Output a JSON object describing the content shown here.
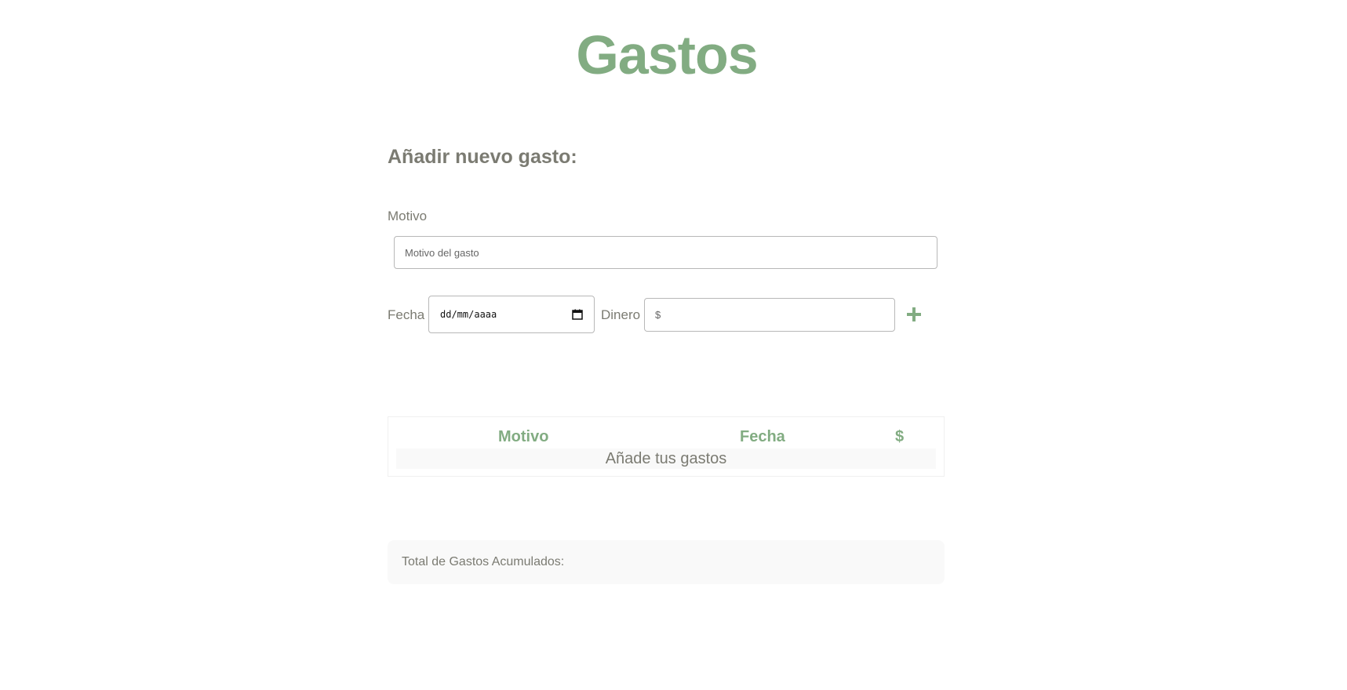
{
  "header": {
    "title": "Gastos"
  },
  "form": {
    "heading": "Añadir nuevo gasto:",
    "motivo_label": "Motivo",
    "motivo_placeholder": "Motivo del gasto",
    "fecha_label": "Fecha",
    "fecha_placeholder": "dd/mm/aaaa",
    "dinero_label": "Dinero",
    "dinero_placeholder": "$",
    "add_icon": "plus-icon"
  },
  "table": {
    "columns": [
      "Motivo",
      "Fecha",
      "$"
    ],
    "empty_message": "Añade tus gastos"
  },
  "summary": {
    "total_label": "Total de Gastos Acumulados:"
  },
  "colors": {
    "accent": "#82ac82",
    "text": "#7b7b72",
    "panel_bg": "#f9f9f9"
  }
}
